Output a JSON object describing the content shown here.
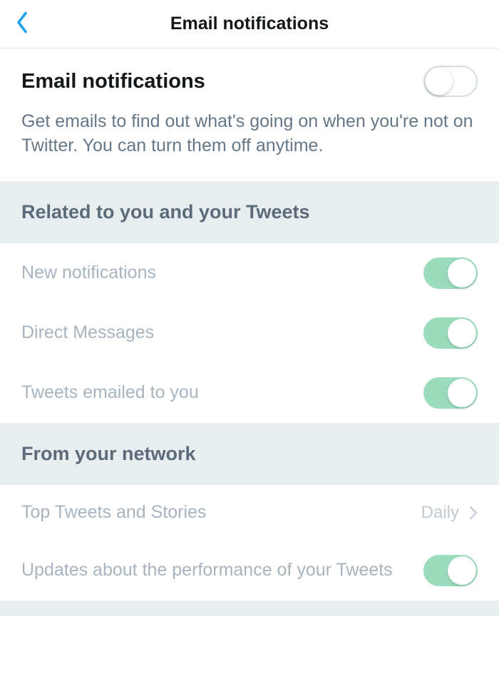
{
  "header": {
    "title": "Email notifications"
  },
  "main": {
    "title": "Email notifications",
    "description": "Get emails to find out what's going on when you're not on Twitter. You can turn them off anytime."
  },
  "sections": {
    "related": {
      "title": "Related to you and your Tweets",
      "items": {
        "new_notifications": "New notifications",
        "direct_messages": "Direct Messages",
        "tweets_emailed": "Tweets emailed to you"
      }
    },
    "network": {
      "title": "From your network",
      "items": {
        "top_tweets": {
          "label": "Top Tweets and Stories",
          "value": "Daily"
        },
        "performance_updates": "Updates about the performance of your Tweets"
      }
    }
  }
}
